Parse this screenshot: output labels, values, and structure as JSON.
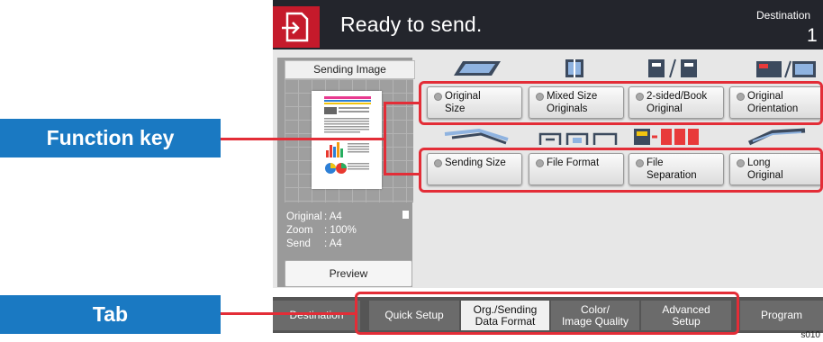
{
  "header": {
    "title": "Ready to send.",
    "destination_label": "Destination",
    "destination_count": "1"
  },
  "preview": {
    "title": "Sending Image",
    "info": [
      {
        "label": "Original",
        "value": ": A4"
      },
      {
        "label": "Zoom",
        "value": ": 100%"
      },
      {
        "label": "Send",
        "value": ": A4"
      }
    ],
    "button": "Preview"
  },
  "functions": {
    "row1": [
      "Original\nSize",
      "Mixed Size\nOriginals",
      "2-sided/Book\nOriginal",
      "Original\nOrientation"
    ],
    "row2": [
      "Sending Size",
      "File Format",
      "File\nSeparation",
      "Long\nOriginal"
    ]
  },
  "tabs": [
    {
      "label": "Destination",
      "active": false
    },
    {
      "label": "Quick Setup",
      "active": false
    },
    {
      "label": "Org./Sending\nData Format",
      "active": true
    },
    {
      "label": "Color/\nImage Quality",
      "active": false
    },
    {
      "label": "Advanced\nSetup",
      "active": false
    },
    {
      "label": "Program",
      "active": false
    }
  ],
  "callouts": {
    "function_key": "Function key",
    "tab": "Tab"
  },
  "figure_code": "s010",
  "colors": {
    "accent_red": "#e32d37",
    "callout_blue": "#1a79c2",
    "header_bg": "#23252c",
    "header_icon_red": "#c51a2b"
  }
}
